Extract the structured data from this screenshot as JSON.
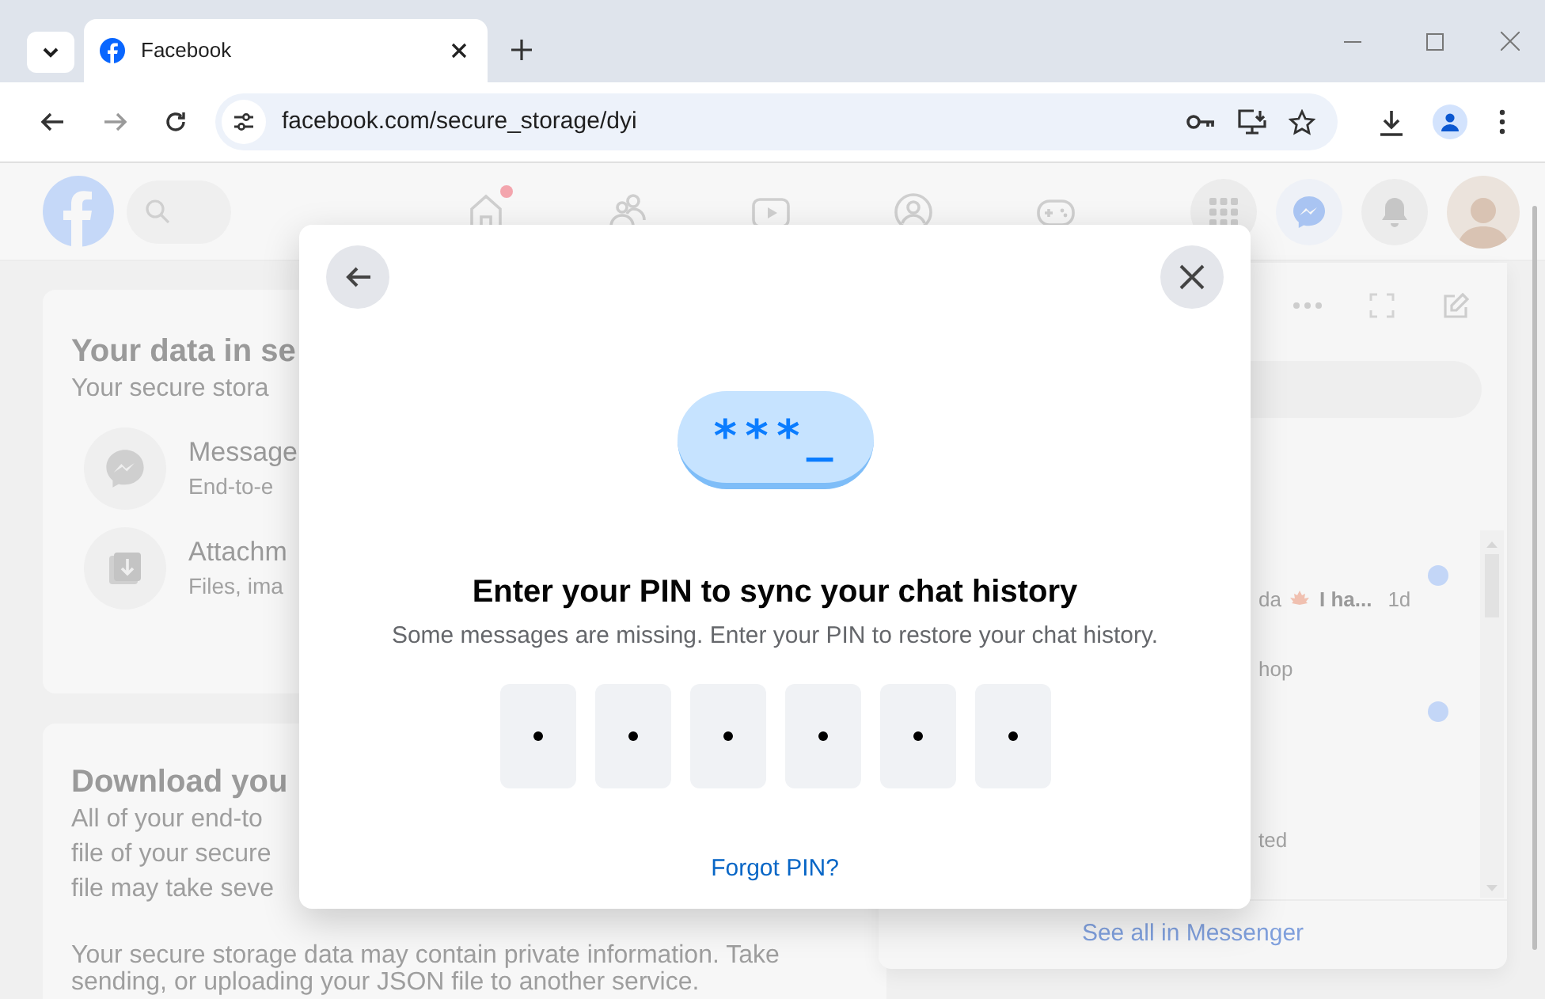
{
  "browser": {
    "tabs": [
      {
        "title": "Facebook",
        "selected": true
      }
    ],
    "address": "facebook.com/secure_storage/dyi",
    "forward": {
      "disabled": true
    }
  },
  "header": {
    "nav": [
      {
        "kind": "home",
        "badge": true
      },
      {
        "kind": "friends",
        "badge": false
      },
      {
        "kind": "watch",
        "badge": false
      },
      {
        "kind": "groups",
        "badge": false
      },
      {
        "kind": "gaming",
        "badge": false
      }
    ]
  },
  "data_card": {
    "title": "Your data in se",
    "subtitle": "Your secure stora",
    "items": [
      {
        "kind": "messages",
        "title": "Message",
        "subtitle": "End-to-e"
      },
      {
        "kind": "attachments",
        "title": "Attachm",
        "subtitle": "Files, ima"
      }
    ]
  },
  "download_card": {
    "title": "Download you",
    "lines": [
      "All of your end-to",
      "file of your secure",
      "file may take seve"
    ],
    "note": [
      "Your secure storage data may contain private information. Take",
      "sending, or uploading your JSON file to another service."
    ]
  },
  "messenger": {
    "rows": [
      {
        "snippet": "da",
        "preview": "I ha...",
        "time": "1d",
        "unread": true
      },
      {
        "snippet": "hop",
        "unread": true
      },
      {
        "snippet": "ted",
        "unread": false
      }
    ],
    "footer": "See all in Messenger"
  },
  "dialog": {
    "illustration": "***_",
    "title": "Enter your PIN to sync your chat history",
    "subtitle": "Some messages are missing. Enter your PIN to restore your chat history.",
    "pin": [
      {
        "filled": true
      },
      {
        "filled": true
      },
      {
        "filled": true
      },
      {
        "filled": true
      },
      {
        "filled": true
      },
      {
        "filled": true
      }
    ],
    "link": "Forgot PIN?"
  }
}
